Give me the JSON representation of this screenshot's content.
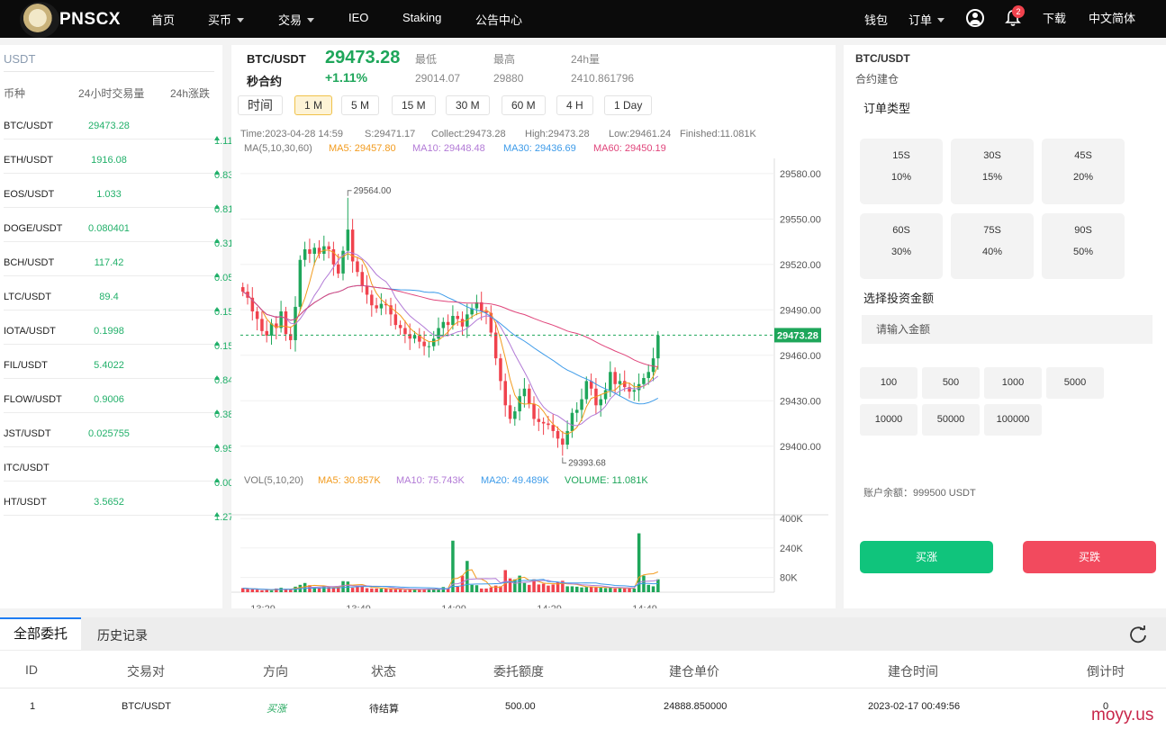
{
  "nav": {
    "logo_text": "PNSCX",
    "items": [
      "首页",
      "买币",
      "交易",
      "IEO",
      "Staking",
      "公告中心"
    ],
    "wallet": "钱包",
    "orders": "订单",
    "notification_count": "2",
    "download": "下载",
    "language": "中文简体"
  },
  "market": {
    "tab": "USDT",
    "headers": [
      "币种",
      "24小时交易量",
      "24h涨跌"
    ],
    "rows": [
      {
        "name": "BTC/USDT",
        "price": "29473.28",
        "change": "1.11%"
      },
      {
        "name": "ETH/USDT",
        "price": "1916.08",
        "change": "0.83%"
      },
      {
        "name": "EOS/USDT",
        "price": "1.033",
        "change": "0.81%"
      },
      {
        "name": "DOGE/USDT",
        "price": "0.080401",
        "change": "0.31%"
      },
      {
        "name": "BCH/USDT",
        "price": "117.42",
        "change": "0.05%"
      },
      {
        "name": "LTC/USDT",
        "price": "89.4",
        "change": "0.15%"
      },
      {
        "name": "IOTA/USDT",
        "price": "0.1998",
        "change": "0.15%"
      },
      {
        "name": "FIL/USDT",
        "price": "5.4022",
        "change": "0.84%"
      },
      {
        "name": "FLOW/USDT",
        "price": "0.9006",
        "change": "0.38%"
      },
      {
        "name": "JST/USDT",
        "price": "0.025755",
        "change": "0.95%"
      },
      {
        "name": "ITC/USDT",
        "price": "",
        "change": "0.00%"
      },
      {
        "name": "HT/USDT",
        "price": "3.5652",
        "change": "1.27%"
      }
    ]
  },
  "ticker": {
    "symbol": "BTC/USDT",
    "contract": "秒合约",
    "last": "29473.28",
    "change": "+1.11%",
    "low_label": "最低",
    "low": "29014.07",
    "high_label": "最高",
    "high": "29880",
    "vol_label": "24h量",
    "vol": "2410.861796"
  },
  "timeframes": [
    "时间",
    "1 M",
    "5 M",
    "15 M",
    "30 M",
    "60 M",
    "4 H",
    "1 Day"
  ],
  "colors": {
    "up": "#1ea65a",
    "down": "#f0424d",
    "ma5": "#f29b1e",
    "ma10": "#b27ad6",
    "ma30": "#3d9be9",
    "ma60": "#e0457b"
  },
  "chart_data": {
    "type": "candlestick",
    "info_line": {
      "time": "Time:2023-04-28 14:59",
      "s": "S:29471.17",
      "collect": "Collect:29473.28",
      "high": "High:29473.28",
      "low": "Low:29461.24",
      "finished": "Finished:11.081K"
    },
    "ma_legend": {
      "label": "MA(5,10,30,60)",
      "ma5": "MA5: 29457.80",
      "ma10": "MA10: 29448.48",
      "ma30": "MA30: 29436.69",
      "ma60": "MA60: 29450.19"
    },
    "vol_legend": {
      "label": "VOL(5,10,20)",
      "ma5": "MA5: 30.857K",
      "ma10": "MA10: 75.743K",
      "ma20": "MA20: 49.489K",
      "volume": "VOLUME: 11.081K"
    },
    "y_ticks": [
      29400,
      29430,
      29460,
      29490,
      29520,
      29550,
      29580
    ],
    "y_tick_labels": [
      "29400.00",
      "29430.00",
      "29460.00",
      "29490.00",
      "29520.00",
      "29550.00",
      "29580.00"
    ],
    "ylim": [
      29385,
      29590
    ],
    "vol_ticks": [
      "80K",
      "240K",
      "400K"
    ],
    "vol_tick_values": [
      80,
      240,
      400
    ],
    "vol_max": 450,
    "x_labels": [
      "13:29",
      "13:49",
      "14:09",
      "14:29",
      "14:49"
    ],
    "x_label_index": [
      1,
      21,
      41,
      61,
      81
    ],
    "current_price": 29473.28,
    "current_price_label": "29473.28",
    "max_label": "29564.00",
    "min_label": "29393.68",
    "max_index": 22,
    "min_index": 67,
    "closes": [
      29502,
      29498,
      29489,
      29484,
      29476,
      29473,
      29481,
      29478,
      29489,
      29474,
      29470,
      29492,
      29523,
      29530,
      29527,
      29531,
      29527,
      29532,
      29530,
      29520,
      29514,
      29529,
      29543,
      29522,
      29515,
      29506,
      29500,
      29493,
      29491,
      29494,
      29493,
      29487,
      29480,
      29478,
      29474,
      29471,
      29473,
      29469,
      29466,
      29466,
      29471,
      29478,
      29482,
      29480,
      29486,
      29484,
      29479,
      29487,
      29491,
      29495,
      29489,
      29488,
      29475,
      29458,
      29443,
      29427,
      29418,
      29423,
      29433,
      29438,
      29428,
      29418,
      29416,
      29415,
      29414,
      29410,
      29405,
      29401,
      29410,
      29422,
      29424,
      29431,
      29443,
      29438,
      29427,
      29431,
      29437,
      29449,
      29441,
      29443,
      29439,
      29436,
      29437,
      29441,
      29445,
      29449,
      29458,
      29473
    ],
    "volumes": [
      22,
      18,
      16,
      14,
      10,
      12,
      9,
      20,
      24,
      16,
      14,
      30,
      40,
      50,
      38,
      27,
      24,
      34,
      28,
      24,
      28,
      60,
      58,
      24,
      34,
      32,
      22,
      20,
      20,
      19,
      20,
      17,
      16,
      15,
      12,
      14,
      18,
      14,
      18,
      20,
      15,
      16,
      28,
      22,
      280,
      30,
      90,
      170,
      40,
      38,
      20,
      20,
      26,
      36,
      32,
      120,
      75,
      70,
      90,
      50,
      40,
      70,
      42,
      46,
      36,
      42,
      55,
      62,
      32,
      32,
      30,
      26,
      28,
      30,
      26,
      24,
      22,
      24,
      20,
      24,
      20,
      22,
      20,
      320,
      90,
      40,
      32,
      70,
      110,
      32,
      24,
      28
    ]
  },
  "order_panel": {
    "symbol": "BTC/USDT",
    "sub": "合约建仓",
    "type_label": "订单类型",
    "types": [
      {
        "duration": "15S",
        "profit": "10%"
      },
      {
        "duration": "30S",
        "profit": "15%"
      },
      {
        "duration": "45S",
        "profit": "20%"
      },
      {
        "duration": "60S",
        "profit": "30%"
      },
      {
        "duration": "75S",
        "profit": "40%"
      },
      {
        "duration": "90S",
        "profit": "50%"
      }
    ],
    "amount_label": "选择投资金额",
    "amount_placeholder": "请输入金额",
    "amounts": [
      "100",
      "500",
      "1000",
      "5000",
      "10000",
      "50000",
      "100000"
    ],
    "balance": "账户余额：999500 USDT",
    "buy_up": "买涨",
    "buy_down": "买跌",
    "buy_up_color": "#10c47c",
    "buy_down_color": "#f24a5e"
  },
  "orders": {
    "tab_all": "全部委托",
    "tab_history": "历史记录",
    "columns": [
      "ID",
      "交易对",
      "方向",
      "状态",
      "委托额度",
      "建仓单价",
      "建仓时间",
      "倒计时"
    ],
    "rows": [
      {
        "id": "1",
        "pair": "BTC/USDT",
        "direction": "买涨",
        "status": "待结算",
        "amount": "500.00",
        "price": "24888.850000",
        "time": "2023-02-17 00:49:56",
        "countdown": "0"
      }
    ]
  },
  "watermark": "moyy.us"
}
